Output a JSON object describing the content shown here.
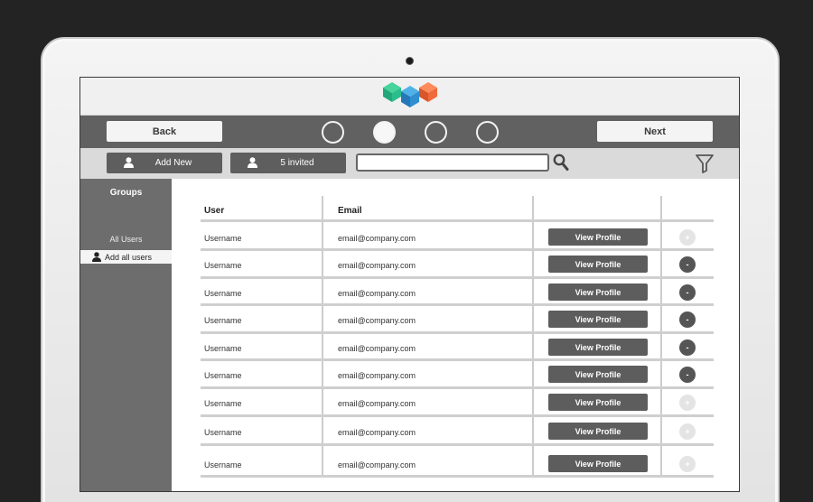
{
  "nav": {
    "back_label": "Back",
    "next_label": "Next",
    "steps": [
      {
        "active": false
      },
      {
        "active": true
      },
      {
        "active": false
      },
      {
        "active": false
      }
    ]
  },
  "toolbar": {
    "add_new_label": "Add New",
    "invited_label": "5 invited",
    "search_placeholder": ""
  },
  "sidebar": {
    "title": "Groups",
    "all_users_label": "All Users",
    "add_all_label": "Add all users"
  },
  "table": {
    "headers": [
      "User",
      "Email",
      "",
      ""
    ],
    "rows": [
      {
        "user": "Username",
        "email": "email@company.com",
        "action": "View Profile",
        "remove": "+",
        "remove_enabled": false
      },
      {
        "user": "Username",
        "email": "email@company.com",
        "action": "View Profile",
        "remove": "-",
        "remove_enabled": true
      },
      {
        "user": "Username",
        "email": "email@company.com",
        "action": "View Profile",
        "remove": "-",
        "remove_enabled": true
      },
      {
        "user": "Username",
        "email": "email@company.com",
        "action": "View Profile",
        "remove": "-",
        "remove_enabled": true
      },
      {
        "user": "Username",
        "email": "email@company.com",
        "action": "View Profile",
        "remove": "-",
        "remove_enabled": true
      },
      {
        "user": "Username",
        "email": "email@company.com",
        "action": "View Profile",
        "remove": "-",
        "remove_enabled": true
      },
      {
        "user": "Username",
        "email": "email@company.com",
        "action": "View Profile",
        "remove": "+",
        "remove_enabled": false
      },
      {
        "user": "Username",
        "email": "email@company.com",
        "action": "View Profile",
        "remove": "+",
        "remove_enabled": false
      },
      {
        "user": "Username",
        "email": "email@company.com",
        "action": "View Profile",
        "remove": "+",
        "remove_enabled": false
      }
    ]
  },
  "colors": {
    "dark_bar": "#616161",
    "button_dark": "#5d5d5d",
    "logo_green": "#2bbd8c",
    "logo_blue": "#2f8fd0",
    "logo_orange": "#f06a3b"
  },
  "icons": {
    "search": "search-icon",
    "filter": "filter-icon",
    "person": "person-icon",
    "logo": "logo-icon"
  }
}
